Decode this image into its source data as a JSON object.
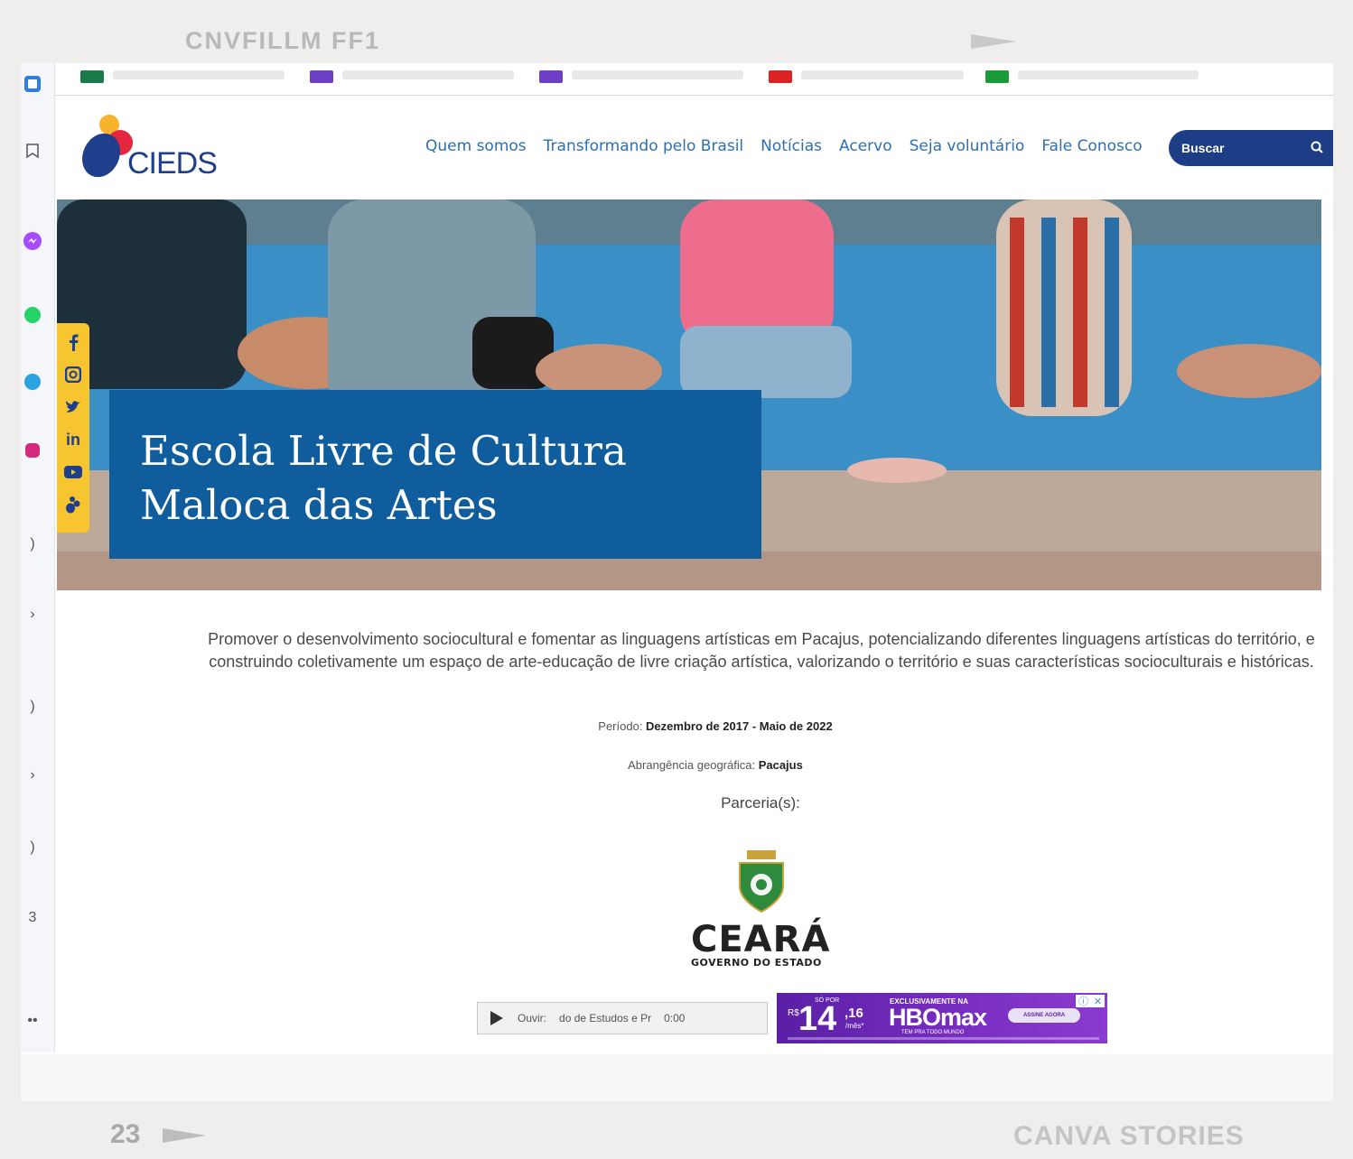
{
  "slide": {
    "top_label": "CNVFILLM FF1",
    "page_number": "23",
    "bottom_label": "CANVA STORIES"
  },
  "site": {
    "logo_text": "CIEDS",
    "nav": [
      "Quem somos",
      "Transformando pelo Brasil",
      "Notícias",
      "Acervo",
      "Seja voluntário",
      "Fale Conosco"
    ],
    "search_placeholder": "Buscar"
  },
  "hero": {
    "title_line1": "Escola Livre de Cultura",
    "title_line2": "Maloca das Artes"
  },
  "social": [
    "facebook-icon",
    "instagram-icon",
    "twitter-icon",
    "linkedin-icon",
    "youtube-icon",
    "cieds-icon"
  ],
  "social_linkedin_text": "in",
  "content": {
    "description": "Promover o desenvolvimento sociocultural e fomentar as linguagens artísticas em Pacajus, potencializando diferentes linguagens artísticas do território, e construindo coletivamente um espaço de arte-educação de livre criação artística, valorizando o território e suas características socioculturais e históricas.",
    "period_label": "Período: ",
    "period_value": "Dezembro de 2017 - Maio de 2022",
    "scope_label": "Abrangência geográfica: ",
    "scope_value": "Pacajus",
    "partners_label": "Parceria(s):"
  },
  "partner": {
    "name": "CEARÁ",
    "subtitle": "GOVERNO DO ESTADO"
  },
  "audio": {
    "label": "Ouvir:",
    "track": "do de Estudos e Pr",
    "time": "0:00"
  },
  "ad": {
    "top_small": "SÓ POR",
    "currency": "R$",
    "price": "14",
    "cents": ",16",
    "per": "/mês*",
    "exclusive": "EXCLUSIVAMENTE NA",
    "brand": "HBOmax",
    "brand_sub": "TEM PRA TODO MUNDO",
    "cta": "ASSINE AGORA"
  },
  "colors": {
    "brand_blue": "#1d3e86",
    "nav_blue": "#2d6fb2",
    "hero_box": "#0f5d9d",
    "social_yellow": "#f6c530"
  }
}
